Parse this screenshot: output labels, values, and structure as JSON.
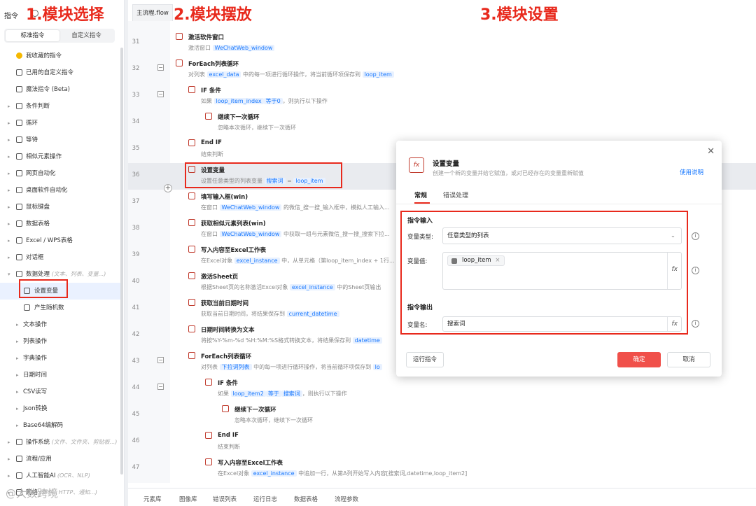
{
  "annotations": {
    "step1": "1.模块选择",
    "step2": "2.模块摆放",
    "step3": "3.模块设置"
  },
  "left": {
    "title": "指令",
    "segments": [
      "标准指令",
      "自定义指令"
    ],
    "items": [
      {
        "label": "我收藏的指令",
        "icon": "heart-icon",
        "level": 0
      },
      {
        "label": "已用的自定义指令",
        "icon": "bag-icon",
        "level": 0
      },
      {
        "label": "魔法指令 (Beta)",
        "icon": "magic-icon",
        "level": 0
      },
      {
        "label": "条件判断",
        "icon": "branch-icon",
        "level": 0
      },
      {
        "label": "循环",
        "icon": "loop-icon",
        "level": 0
      },
      {
        "label": "等待",
        "icon": "hourglass-icon",
        "level": 0
      },
      {
        "label": "相似元素操作",
        "icon": "similar-icon",
        "level": 0
      },
      {
        "label": "网页自动化",
        "icon": "globe-icon",
        "level": 0
      },
      {
        "label": "桌面软件自动化",
        "icon": "desktop-icon",
        "level": 0
      },
      {
        "label": "鼠标键盘",
        "icon": "cursor-icon",
        "level": 0
      },
      {
        "label": "数据表格",
        "icon": "table-icon",
        "level": 0
      },
      {
        "label": "Excel / WPS表格",
        "icon": "excel-icon",
        "level": 0
      },
      {
        "label": "对话框",
        "icon": "dialog-icon",
        "level": 0
      },
      {
        "label": "数据处理",
        "sub": "(文本、列表、变量...)",
        "icon": "data-icon",
        "level": 0
      },
      {
        "label": "设置变量",
        "icon": "variable-icon",
        "level": 2
      },
      {
        "label": "产生随机数",
        "icon": "random-icon",
        "level": 2
      },
      {
        "label": "文本操作",
        "level": 1
      },
      {
        "label": "列表操作",
        "level": 1
      },
      {
        "label": "字典操作",
        "level": 1
      },
      {
        "label": "日期时间",
        "level": 1
      },
      {
        "label": "CSV读写",
        "level": 1
      },
      {
        "label": "Json转换",
        "level": 1
      },
      {
        "label": "Base64编解码",
        "level": 1
      },
      {
        "label": "操作系统",
        "sub": "(文件、文件夹、剪贴板...)",
        "icon": "os-icon",
        "level": 0
      },
      {
        "label": "流程/应用",
        "icon": "flow-icon",
        "level": 0
      },
      {
        "label": "人工智能AI",
        "sub": "(OCR、NLP)",
        "icon": "ai-icon",
        "level": 0
      },
      {
        "label": "网络",
        "sub": "(邮件、HTTP、通知...)",
        "icon": "network-icon",
        "level": 0
      }
    ],
    "watermark": "@大数跨境"
  },
  "editor": {
    "tab": "主流程.flow",
    "rows": [
      {
        "ln": "31",
        "title": "激活软件窗口",
        "desc": [
          "激活窗口 ",
          {
            "chip": "WeChatWeb_window"
          }
        ],
        "indent": 0
      },
      {
        "ln": "32",
        "title": "ForEach列表循环",
        "desc": [
          "对列表 ",
          {
            "chip": "excel_data"
          },
          " 中的每一项进行循环操作，将当前循环项保存到 ",
          {
            "chip": "loop_item"
          }
        ],
        "indent": 0,
        "collapse": true
      },
      {
        "ln": "33",
        "title": "IF 条件",
        "desc": [
          "如果 ",
          {
            "chip": "loop_item_index"
          },
          {
            "chip": "等于0"
          },
          "，则执行以下操作"
        ],
        "indent": 1,
        "collapse": true
      },
      {
        "ln": "34",
        "title": "继续下一次循环",
        "desc": [
          "忽略本次循环，继续下一次循环"
        ],
        "indent": 2
      },
      {
        "ln": "35",
        "title": "End IF",
        "desc": [
          "结束判断"
        ],
        "indent": 1
      },
      {
        "ln": "36",
        "title": "设置变量",
        "desc": [
          "设置任意类型的列表变量 ",
          {
            "chip": "搜索词"
          },
          " = ",
          {
            "chip": "loop_item"
          }
        ],
        "indent": 1,
        "highlight": true
      },
      {
        "ln": "37",
        "title": "填写输入框(win)",
        "desc": [
          "在窗口 ",
          {
            "chip": "WeChatWeb_window"
          },
          " 的微信_搜一搜_输入框中，模拟人工输入..."
        ],
        "indent": 1
      },
      {
        "ln": "38",
        "title": "获取相似元素列表(win)",
        "desc": [
          "在窗口 ",
          {
            "chip": "WeChatWeb_window"
          },
          " 中获取一组与元素微信_搜一搜_搜索下拉..."
        ],
        "indent": 1
      },
      {
        "ln": "39",
        "title": "写入内容至Excel工作表",
        "desc": [
          "在Excel对象 ",
          {
            "chip": "excel_instance"
          },
          " 中，从单元格（第loop_item_index + 1行..."
        ],
        "indent": 1
      },
      {
        "ln": "40",
        "title": "激活Sheet页",
        "desc": [
          "根据Sheet页的名称激活Excel对象 ",
          {
            "chip": "excel_instance"
          },
          " 中的Sheet页输出"
        ],
        "indent": 1
      },
      {
        "ln": "41",
        "title": "获取当前日期时间",
        "desc": [
          "获取当前日期时间，将结果保存到 ",
          {
            "chip": "current_datetime"
          }
        ],
        "indent": 1
      },
      {
        "ln": "42",
        "title": "日期时间转换为文本",
        "desc": [
          "将按%Y-%m-%d %H:%M:%S格式转换文本，将结果保存到 ",
          {
            "chip": "datetime"
          }
        ],
        "indent": 1
      },
      {
        "ln": "43",
        "title": "ForEach列表循环",
        "desc": [
          "对列表 ",
          {
            "chip": "下拉词列表"
          },
          " 中的每一项进行循环操作，将当前循环项保存到 ",
          {
            "chip": "lo"
          }
        ],
        "indent": 1,
        "collapse": true
      },
      {
        "ln": "44",
        "title": "IF 条件",
        "desc": [
          "如果 ",
          {
            "chip": "loop_item2"
          },
          {
            "chip": "等于"
          },
          {
            "chip": "搜索词"
          },
          "，则执行以下操作"
        ],
        "indent": 2,
        "collapse": true
      },
      {
        "ln": "45",
        "title": "继续下一次循环",
        "desc": [
          "忽略本次循环，继续下一次循环"
        ],
        "indent": 3
      },
      {
        "ln": "46",
        "title": "End IF",
        "desc": [
          "结束判断"
        ],
        "indent": 2
      },
      {
        "ln": "47",
        "title": "写入内容至Excel工作表",
        "desc": [
          "在Excel对象 ",
          {
            "chip": "excel_instance"
          },
          " 中追加一行，从第A列开始写入内容[搜索词,datetime,loop_item2]"
        ],
        "indent": 2
      }
    ],
    "bottom_tabs": [
      "元素库",
      "图像库",
      "错误列表",
      "运行日志",
      "数据表格",
      "流程参数"
    ]
  },
  "modal": {
    "title": "设置变量",
    "desc": "创建一个新的变量并给它赋值，或对已经存在的变量重新赋值",
    "help": "使用说明",
    "tabs": [
      "常规",
      "错误处理"
    ],
    "input_section": "指令输入",
    "var_type_label": "变量类型:",
    "var_type_value": "任意类型的列表",
    "var_value_label": "变量值:",
    "var_value_tag": "loop_item",
    "output_section": "指令输出",
    "var_name_label": "变量名:",
    "var_name_value": "搜索词",
    "run_button": "运行指令",
    "ok_button": "确定",
    "cancel_button": "取消",
    "accent": "#f0504a"
  }
}
